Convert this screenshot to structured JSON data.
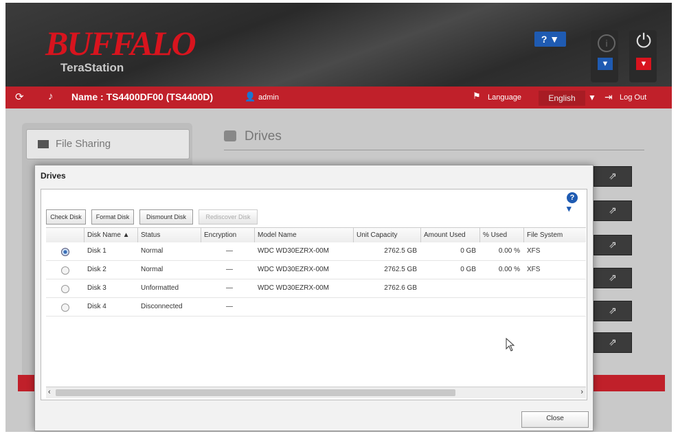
{
  "header": {
    "brand": "BUFFALO",
    "product": "TeraStation",
    "help_label": "? ▼",
    "dropdown_arrow": "▼"
  },
  "topbar": {
    "name_text": "Name : TS4400DF00 (TS4400D)",
    "user": "admin",
    "language_label": "Language",
    "language_value": "English",
    "logout_label": "Log Out"
  },
  "sidebar": {
    "section_label": "File Sharing"
  },
  "main": {
    "title": "Drives"
  },
  "dialog": {
    "title": "Drives",
    "toolbar": {
      "check_disk": "Check Disk",
      "format_disk": "Format Disk",
      "dismount_disk": "Dismount Disk",
      "rediscover_disk": "Rediscover Disk"
    },
    "columns": [
      "Disk Name ▲",
      "Status",
      "Encryption",
      "Model Name",
      "Unit Capacity",
      "Amount Used",
      "% Used",
      "File System"
    ],
    "rows": [
      {
        "name": "Disk 1",
        "status": "Normal",
        "encryption": "—",
        "model": "WDC WD30EZRX-00M",
        "capacity": "2762.5 GB",
        "used": "0 GB",
        "pct": "0.00 %",
        "fs": "XFS",
        "selected": true
      },
      {
        "name": "Disk 2",
        "status": "Normal",
        "encryption": "—",
        "model": "WDC WD30EZRX-00M",
        "capacity": "2762.5 GB",
        "used": "0 GB",
        "pct": "0.00 %",
        "fs": "XFS",
        "selected": false
      },
      {
        "name": "Disk 3",
        "status": "Unformatted",
        "encryption": "—",
        "model": "WDC WD30EZRX-00M",
        "capacity": "2762.6 GB",
        "used": "",
        "pct": "",
        "fs": "",
        "selected": false
      },
      {
        "name": "Disk 4",
        "status": "Disconnected",
        "encryption": "—",
        "model": "",
        "capacity": "",
        "used": "",
        "pct": "",
        "fs": "",
        "selected": false
      }
    ],
    "close_label": "Close"
  },
  "colors": {
    "brand_red": "#d8141e",
    "bar_red": "#c0202a",
    "accent_blue": "#1f5bb2"
  }
}
